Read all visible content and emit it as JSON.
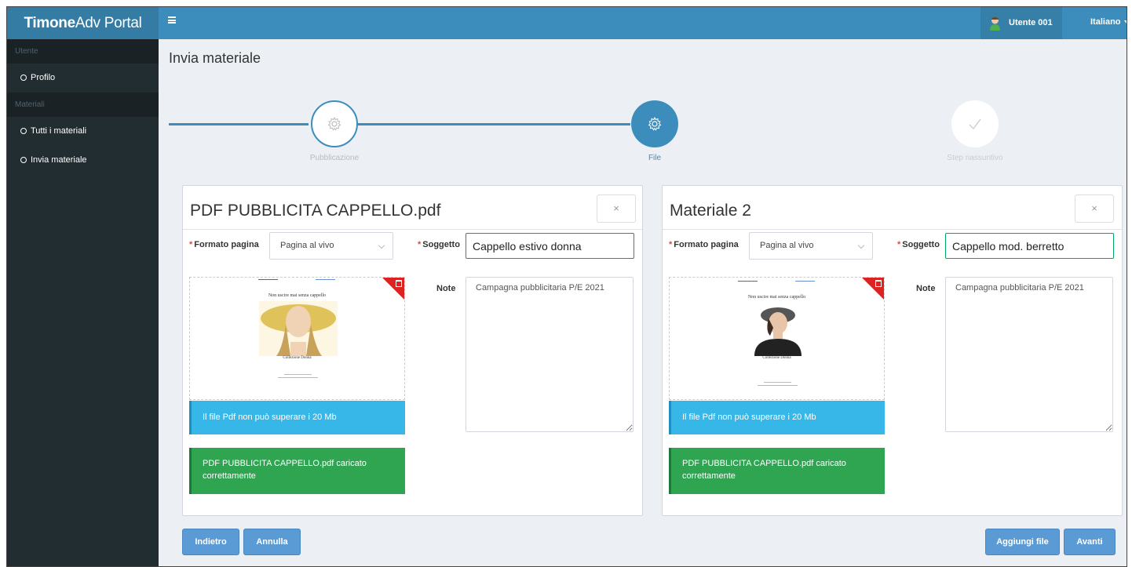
{
  "app": {
    "brand_bold": "Timone",
    "brand_light": "Adv Portal"
  },
  "header": {
    "user_name": "Utente 001",
    "language": "Italiano"
  },
  "sidebar": {
    "sections": [
      {
        "title": "Utente",
        "items": [
          {
            "label": "Profilo"
          }
        ]
      },
      {
        "title": "Materiali",
        "items": [
          {
            "label": "Tutti i materiali"
          },
          {
            "label": "Invia materiale"
          }
        ]
      }
    ]
  },
  "page": {
    "title": "Invia materiale"
  },
  "steps": [
    {
      "label": "Pubblicazione",
      "state": "done",
      "icon": "gear-icon"
    },
    {
      "label": "File",
      "state": "active",
      "icon": "gear-icon"
    },
    {
      "label": "Step riassuntivo",
      "state": "pending",
      "icon": "check-icon"
    }
  ],
  "colors": {
    "accent": "#3c8dbc",
    "sidebar": "#222d32",
    "info": "#37b6e8",
    "success": "#2fa552",
    "danger": "#dd2222"
  },
  "panels": [
    {
      "title": "PDF PUBBLICITA CAPPELLO.pdf",
      "close_label": "×",
      "format_label": "Formato pagina",
      "format_value": "Pagina al vivo",
      "subject_label": "Soggetto",
      "subject_value": "Cappello estivo donna",
      "notes_label": "Note",
      "notes_value": "Campagna pubblicitaria P/E 2021",
      "preview_heading": "Non uscire mai senza cappello",
      "preview_caption": "Collezione Donna",
      "info_alert": "Il file Pdf non può superare i 20 Mb",
      "success_alert": "PDF PUBBLICITA CAPPELLO.pdf caricato correttamente"
    },
    {
      "title": "Materiale 2",
      "close_label": "×",
      "format_label": "Formato pagina",
      "format_value": "Pagina al vivo",
      "subject_label": "Soggetto",
      "subject_value": "Cappello mod. berretto",
      "notes_label": "Note",
      "notes_value": "Campagna pubblicitaria P/E 2021",
      "preview_heading": "Non uscire mai senza cappello",
      "preview_caption": "Collezione Donna",
      "info_alert": "Il file Pdf non può superare i 20 Mb",
      "success_alert": "PDF PUBBLICITA CAPPELLO.pdf caricato correttamente"
    }
  ],
  "actions": {
    "back": "Indietro",
    "cancel": "Annulla",
    "add_file": "Aggiungi file",
    "next": "Avanti"
  }
}
